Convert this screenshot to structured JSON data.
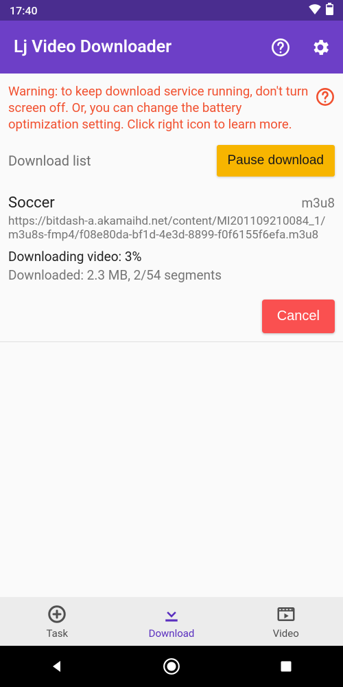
{
  "status_bar": {
    "time": "17:40"
  },
  "app_bar": {
    "title": "Lj Video Downloader"
  },
  "warning": {
    "text": "Warning: to keep download service running, don't turn screen off. Or, you can change the battery optimization setting. Click right icon to learn more."
  },
  "list": {
    "title": "Download list",
    "pause_label": "Pause download"
  },
  "download": {
    "name": "Soccer",
    "format": "m3u8",
    "url": "https://bitdash-a.akamaihd.net/content/MI201109210084_1/m3u8s-fmp4/f08e80da-bf1d-4e3d-8899-f0f6155f6efa.m3u8",
    "status": "Downloading video: 3%",
    "progress": "Downloaded: 2.3 MB, 2/54 segments",
    "cancel_label": "Cancel"
  },
  "nav": {
    "task": "Task",
    "download": "Download",
    "video": "Video"
  }
}
